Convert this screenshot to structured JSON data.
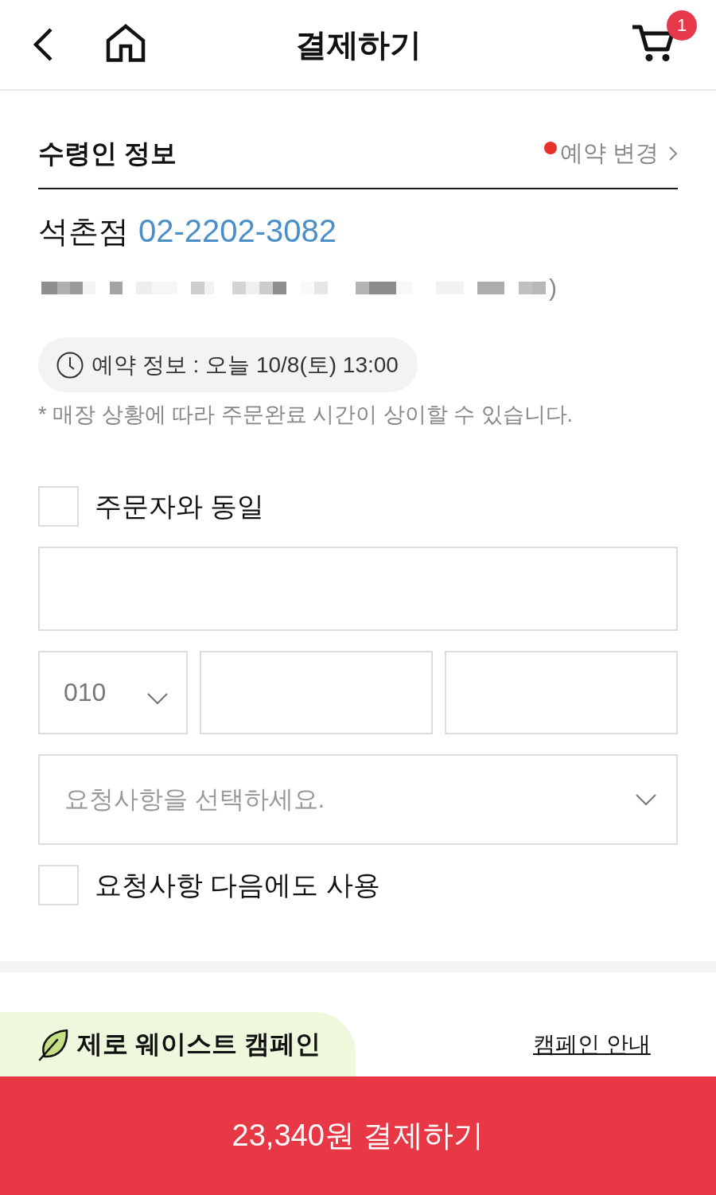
{
  "header": {
    "title": "결제하기",
    "cart_count": "1"
  },
  "recipient": {
    "title": "수령인 정보",
    "change_link": {
      "label": "예약 변경",
      "notice_dot": true
    },
    "store_name": "석촌점",
    "store_phone": "02-2202-3082",
    "address_tail": ")"
  },
  "reservation": {
    "info": "예약 정보 : 오늘 10/8(토) 13:00",
    "note": "* 매장 상황에 따라 주문완료 시간이 상이할 수 있습니다."
  },
  "form": [
    {
      "kind": "checkbox",
      "label": "주문자와 동일",
      "checked": false
    },
    {
      "kind": "text_input"
    },
    {
      "kind": "phone",
      "prefix": "010"
    },
    {
      "kind": "select",
      "placeholder": "요청사항을 선택하세요."
    },
    {
      "kind": "checkbox",
      "label": "요청사항 다음에도 사용",
      "checked": false
    }
  ],
  "campaign": {
    "title": "제로 웨이스트 캠페인",
    "info_link": "캠페인 안내"
  },
  "pay_button": {
    "label": "23,340원 결제하기"
  }
}
